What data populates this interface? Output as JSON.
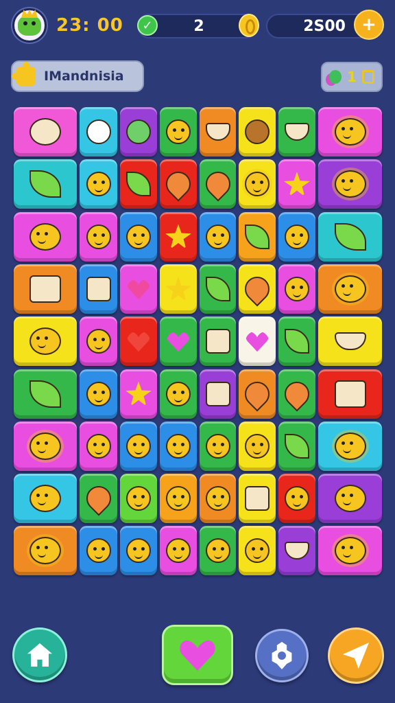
{
  "hud": {
    "timer": "23: 00",
    "moves": "2",
    "score": "2S00",
    "avatar": "frog-king-avatar",
    "plus_icon": "plus-icon"
  },
  "level": {
    "label": "IMandnisia",
    "hint_count": "1"
  },
  "board": {
    "columns": 8,
    "rows": 9,
    "tiles": [
      [
        "#f058d8",
        "ticket"
      ],
      [
        "#34c6e4",
        "ghost"
      ],
      [
        "#9a3ed8",
        "blob"
      ],
      [
        "#34b84a",
        "face"
      ],
      [
        "#f08a22",
        "bowl"
      ],
      [
        "#f6e21a",
        "acorn"
      ],
      [
        "#34b84a",
        "bowl"
      ],
      [
        "#e84ee0",
        "sun"
      ],
      [
        "#2cc6cf",
        "leaf"
      ],
      [
        "#34c6e4",
        "face"
      ],
      [
        "#e8261c",
        "leaf"
      ],
      [
        "#e8261c",
        "drop"
      ],
      [
        "#34b84a",
        "drop"
      ],
      [
        "#f6e21a",
        "sun"
      ],
      [
        "#e84ee0",
        "star"
      ],
      [
        "#9a3ed8",
        "sun"
      ],
      [
        "#e84ee0",
        "face"
      ],
      [
        "#e84ee0",
        "face"
      ],
      [
        "#2d8ee8",
        "face"
      ],
      [
        "#e8261c",
        "star"
      ],
      [
        "#2d8ee8",
        "face"
      ],
      [
        "#f6a21a",
        "leaf"
      ],
      [
        "#2d8ee8",
        "face"
      ],
      [
        "#2cc6cf",
        "leaf"
      ],
      [
        "#f08a22",
        "box"
      ],
      [
        "#2d8ee8",
        "box"
      ],
      [
        "#e84ee0",
        "heart"
      ],
      [
        "#f6e21a",
        "star"
      ],
      [
        "#34b84a",
        "leaf"
      ],
      [
        "#f6e21a",
        "drop"
      ],
      [
        "#e84ee0",
        "face"
      ],
      [
        "#f08a22",
        "sun"
      ],
      [
        "#f6e21a",
        "face"
      ],
      [
        "#e84ee0",
        "face"
      ],
      [
        "#e8261c",
        "heart"
      ],
      [
        "#34b84a",
        "heart"
      ],
      [
        "#34b84a",
        "box"
      ],
      [
        "#f8f4e8",
        "heart"
      ],
      [
        "#34b84a",
        "leaf"
      ],
      [
        "#f6e21a",
        "bowl"
      ],
      [
        "#34b84a",
        "leaf"
      ],
      [
        "#2d8ee8",
        "face"
      ],
      [
        "#e84ee0",
        "star"
      ],
      [
        "#34b84a",
        "face"
      ],
      [
        "#9a3ed8",
        "box"
      ],
      [
        "#f08a22",
        "drop"
      ],
      [
        "#34b84a",
        "drop"
      ],
      [
        "#e8261c",
        "box"
      ],
      [
        "#e84ee0",
        "sun"
      ],
      [
        "#e84ee0",
        "face"
      ],
      [
        "#2d8ee8",
        "face"
      ],
      [
        "#2d8ee8",
        "face"
      ],
      [
        "#34b84a",
        "face"
      ],
      [
        "#f6e21a",
        "face"
      ],
      [
        "#34b84a",
        "leaf"
      ],
      [
        "#34c6e4",
        "sun"
      ],
      [
        "#34c6e4",
        "face"
      ],
      [
        "#34b84a",
        "drop"
      ],
      [
        "#62d63a",
        "face"
      ],
      [
        "#f6a21a",
        "face"
      ],
      [
        "#f08a22",
        "face"
      ],
      [
        "#f6e21a",
        "box"
      ],
      [
        "#e8261c",
        "face"
      ],
      [
        "#9a3ed8",
        "face"
      ],
      [
        "#f08a22",
        "sun"
      ],
      [
        "#2d8ee8",
        "face"
      ],
      [
        "#2d8ee8",
        "face"
      ],
      [
        "#e84ee0",
        "face"
      ],
      [
        "#34b84a",
        "face"
      ],
      [
        "#f6e21a",
        "face"
      ],
      [
        "#9a3ed8",
        "bowl"
      ],
      [
        "#e84ee0",
        "sun"
      ]
    ]
  },
  "colors": {
    "background": "#2c3a78",
    "timer": "#f6c62c",
    "hint_count": "#e6d12a"
  },
  "bottom_bar": {
    "home": "home-icon",
    "lives": "heart-icon",
    "settings": "gear-icon",
    "play": "paper-plane-icon"
  }
}
